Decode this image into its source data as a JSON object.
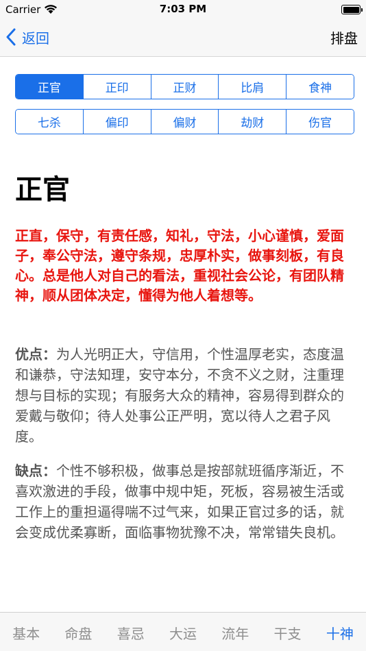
{
  "status_bar": {
    "carrier": "Carrier",
    "time": "7:03 PM",
    "wifi_icon": "wifi-icon",
    "battery_icon": "battery-icon"
  },
  "nav": {
    "back_label": "返回",
    "back_icon": "chevron-left-icon",
    "action_label": "排盘"
  },
  "ten_gods": {
    "row1": [
      "正官",
      "正印",
      "正财",
      "比肩",
      "食神"
    ],
    "row2": [
      "七杀",
      "偏印",
      "偏财",
      "劫财",
      "伤官"
    ],
    "selected": "正官"
  },
  "detail": {
    "title": "正官",
    "summary": "正直，保守，有责任感，知礼，守法，小心谨慎，爱面子，奉公守法，遵守条规，忠厚朴实，做事刻板，有良心。总是他人对自己的看法，重视社会公论，有团队精神，顺从团体决定，懂得为他人着想等。",
    "pros_label": "优点：",
    "pros_text": "为人光明正大，守信用，个性温厚老实，态度温和谦恭，守法知理，安守本分，不贪不义之财，注重理想与目标的实现；有服务大众的精神，容易得到群众的爱戴与敬仰；待人处事公正严明，宽以待人之君子风度。",
    "cons_label": "缺点：",
    "cons_text": "个性不够积极，做事总是按部就班循序渐近，不喜欢激进的手段，做事中规中矩，死板，容易被生活或工作上的重担逼得喘不过气来，如果正官过多的话，就会变成优柔寡断，面临事物犹豫不决，常常错失良机。"
  },
  "tab_bar": {
    "items": [
      "基本",
      "命盘",
      "喜忌",
      "大运",
      "流年",
      "干支",
      "十神"
    ],
    "active": "十神"
  },
  "colors": {
    "accent": "#1a6fe8",
    "summary_red": "#e8150f",
    "body_gray": "#555555",
    "tab_inactive": "#8e8e8e"
  }
}
